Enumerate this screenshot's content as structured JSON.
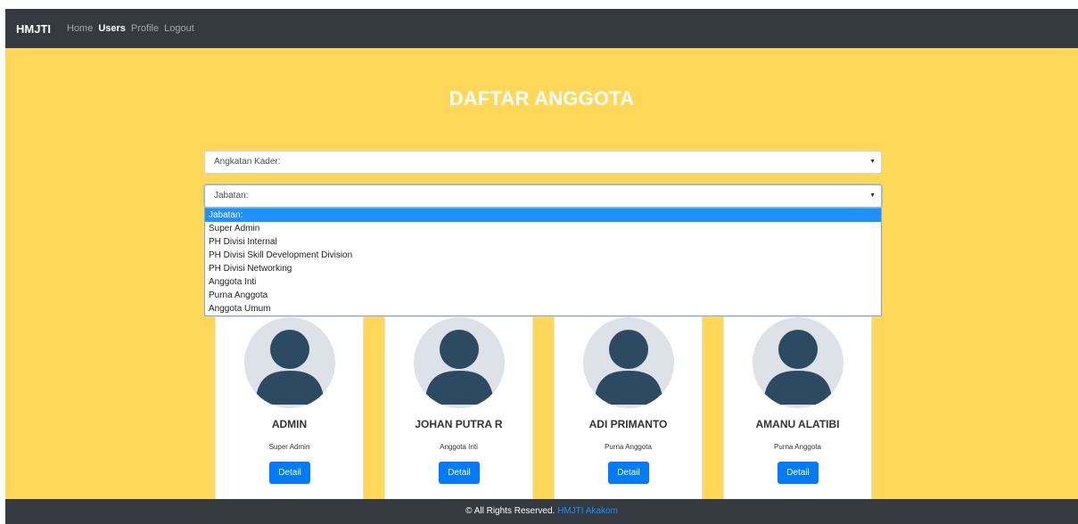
{
  "navbar": {
    "brand": "HMJTI",
    "links": [
      {
        "label": "Home",
        "active": false
      },
      {
        "label": "Users",
        "active": true
      },
      {
        "label": "Profile",
        "active": false
      },
      {
        "label": "Logout",
        "active": false
      }
    ]
  },
  "page": {
    "title": "DAFTAR ANGGOTA"
  },
  "filters": {
    "angkatan": {
      "value": "Angkatan Kader:"
    },
    "jabatan": {
      "value": "Jabatan:",
      "options": [
        "Jabatan:",
        "Super Admin",
        "PH Divisi Internal",
        "PH Divisi Skill Development Division",
        "PH Divisi Networking",
        "Anggota Inti",
        "Purna Anggota",
        "Anggota Umum"
      ],
      "highlighted_index": 0
    }
  },
  "members": [
    {
      "name": "ADMIN",
      "role": "Super Admin",
      "button": "Detail"
    },
    {
      "name": "JOHAN PUTRA R",
      "role": "Anggota Inti",
      "button": "Detail"
    },
    {
      "name": "ADI PRIMANTO",
      "role": "Purna Anggota",
      "button": "Detail"
    },
    {
      "name": "AMANU ALATIBI",
      "role": "Purna Anggota",
      "button": "Detail"
    }
  ],
  "footer": {
    "text": "© All Rights Reserved.",
    "link": "HMJTI Akakom"
  },
  "colors": {
    "background": "#ffd85a",
    "navbar": "#343a40",
    "primary": "#007bff",
    "avatar_bg": "#dde1e8",
    "avatar_fg": "#2c4a61"
  }
}
